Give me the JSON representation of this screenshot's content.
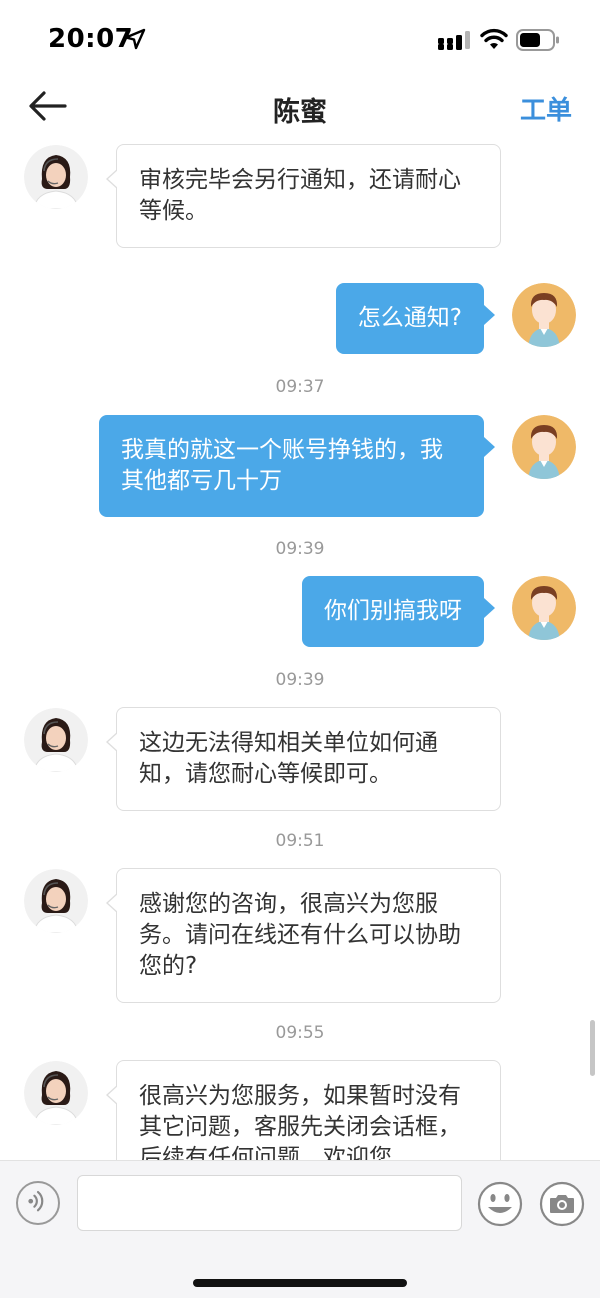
{
  "status_bar": {
    "time": "20:07"
  },
  "header": {
    "title": "陈蜜",
    "action_label": "工单"
  },
  "messages": [
    {
      "sender": "agent",
      "text": "审核完毕会另行通知，还请耐心等候。"
    },
    {
      "sender": "user",
      "text": "怎么通知?"
    },
    {
      "timestamp": "09:37"
    },
    {
      "sender": "user",
      "text": "我真的就这一个账号挣钱的，我其他都亏几十万"
    },
    {
      "timestamp": "09:39"
    },
    {
      "sender": "user",
      "text": "你们别搞我呀"
    },
    {
      "timestamp": "09:39"
    },
    {
      "sender": "agent",
      "text": "这边无法得知相关单位如何通知，请您耐心等候即可。"
    },
    {
      "timestamp": "09:51"
    },
    {
      "sender": "agent",
      "text": "感谢您的咨询，很高兴为您服务。请问在线还有什么可以协助您的?"
    },
    {
      "timestamp": "09:55"
    },
    {
      "sender": "agent",
      "text": "很高兴为您服务，如果暂时没有其它问题，客服先关闭会话框，后续有任何问题，欢迎您"
    }
  ],
  "input": {
    "value": "",
    "placeholder": ""
  },
  "icons": {
    "back": "arrow-left-icon",
    "voice": "voice-icon",
    "emoji": "smiley-icon",
    "camera": "camera-icon"
  },
  "colors": {
    "accent": "#3b8fdc",
    "outgoing_bubble": "#4ba8e8",
    "incoming_bubble": "#ffffff",
    "timestamp": "#999999"
  }
}
